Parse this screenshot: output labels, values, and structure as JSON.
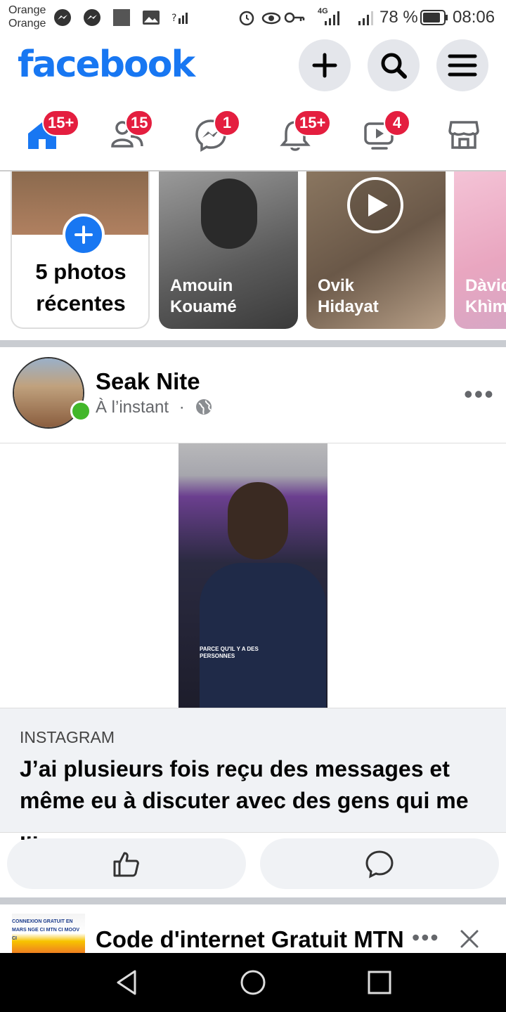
{
  "status_bar": {
    "carrier_1": "Orange",
    "carrier_2": "Orange",
    "network": "4G",
    "battery": "78 %",
    "time": "08:06"
  },
  "header": {
    "logo": "facebook",
    "buttons": [
      "plus-icon",
      "search-icon",
      "menu-icon"
    ]
  },
  "nav_tabs": [
    {
      "icon": "home-icon",
      "badge": "15+"
    },
    {
      "icon": "friends-icon",
      "badge": "15"
    },
    {
      "icon": "messenger-icon",
      "badge": "1"
    },
    {
      "icon": "bell-icon",
      "badge": "15+"
    },
    {
      "icon": "video-icon",
      "badge": "4"
    },
    {
      "icon": "marketplace-icon",
      "badge": ""
    }
  ],
  "stories": {
    "create": {
      "label": "5 photos récentes"
    },
    "items": [
      {
        "name": "Amouin Kouamé"
      },
      {
        "name": "Ovik Hidayat"
      },
      {
        "name": "Dàvid Khìm"
      }
    ]
  },
  "post": {
    "author": "Seak Nite",
    "time": "À l’instant",
    "dot": "·",
    "video_caption": "PARCE QU'IL Y A DES PERSONNES",
    "link_source": "INSTAGRAM",
    "link_title": "J’ai plusieurs fois reçu des messages et même eu à discuter avec des gens qui me ..."
  },
  "next_post": {
    "title": "Code d'internet Gratuit MTN",
    "thumb_text": "CONNEXION GRATUIT EN MARS NGE CI MTN CI MOOV CI"
  },
  "colors": {
    "brand": "#1877f2",
    "badge": "#e41e3f",
    "online": "#42b72a"
  }
}
